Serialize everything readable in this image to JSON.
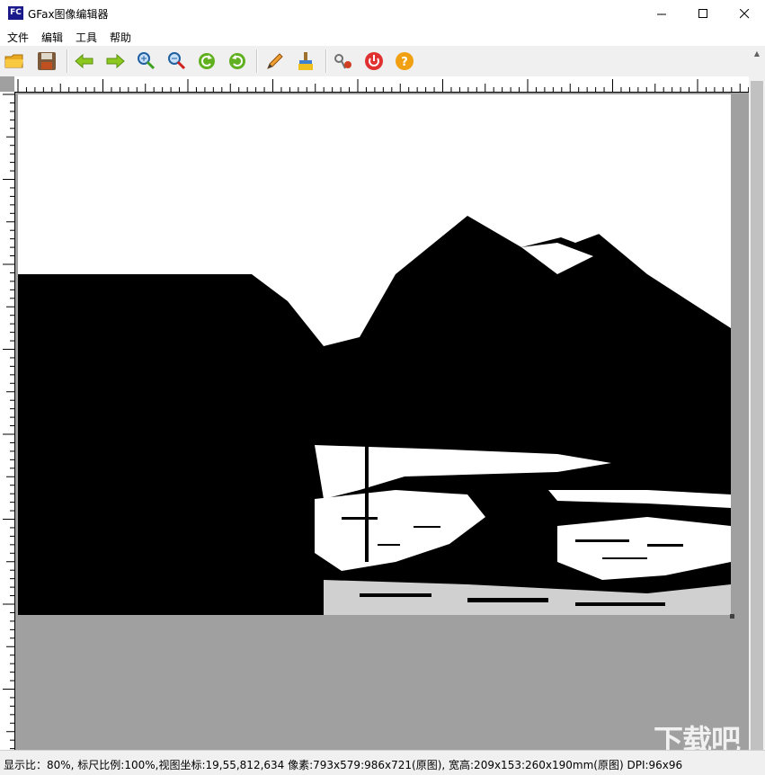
{
  "window": {
    "title": "GFax图像编辑器",
    "icon_label": "FC"
  },
  "menu": {
    "items": [
      {
        "label": "文件"
      },
      {
        "label": "编辑"
      },
      {
        "label": "工具"
      },
      {
        "label": "帮助"
      }
    ]
  },
  "toolbar": {
    "buttons": [
      {
        "icon": "open-folder-icon"
      },
      {
        "icon": "save-icon"
      },
      {
        "icon": "arrow-left-icon"
      },
      {
        "icon": "arrow-right-icon"
      },
      {
        "icon": "zoom-in-icon"
      },
      {
        "icon": "zoom-out-icon"
      },
      {
        "icon": "rotate-left-icon"
      },
      {
        "icon": "rotate-right-icon"
      },
      {
        "icon": "pencil-icon"
      },
      {
        "icon": "eraser-brush-icon"
      },
      {
        "icon": "settings-tools-icon"
      },
      {
        "icon": "power-icon"
      },
      {
        "icon": "help-icon"
      }
    ]
  },
  "status": {
    "text": "显示比：80%, 标尺比例:100%,视图坐标:19,55,812,634 像素:793x579:986x721(原图), 宽高:209x153:260x190mm(原图) DPI:96x96"
  },
  "watermark": {
    "text": "下载吧"
  },
  "colors": {
    "canvas_bg": "#a0a0a0",
    "toolbar_bg": "#f0f0f0",
    "image_black": "#000000",
    "image_white": "#ffffff"
  }
}
